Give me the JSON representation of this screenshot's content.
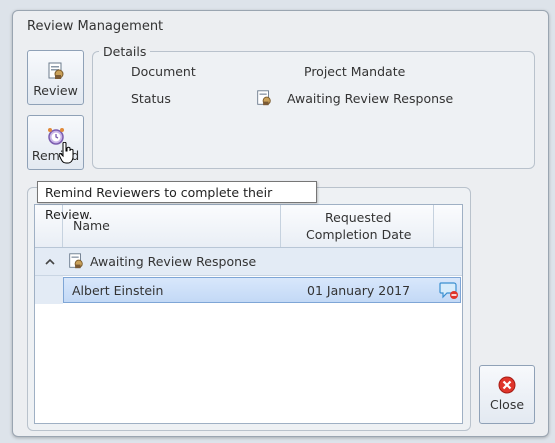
{
  "window": {
    "title": "Review Management"
  },
  "toolbar": {
    "review_label": "Review",
    "remind_label": "Remind",
    "close_label": "Close"
  },
  "details": {
    "legend": "Details",
    "document_label": "Document",
    "document_value": "Project Mandate",
    "status_label": "Status",
    "status_value": "Awaiting Review Response"
  },
  "tooltip": {
    "text": "Remind Reviewers to complete their Review."
  },
  "grid": {
    "columns": [
      "Name",
      "Requested",
      "Completion Date"
    ],
    "group": {
      "label": "Awaiting Review Response"
    },
    "rows": [
      {
        "name": "Albert Einstein",
        "date": "01 January 2017"
      }
    ]
  },
  "colors": {
    "accent": "#7fa6d6",
    "close_icon": "#e0352b"
  }
}
